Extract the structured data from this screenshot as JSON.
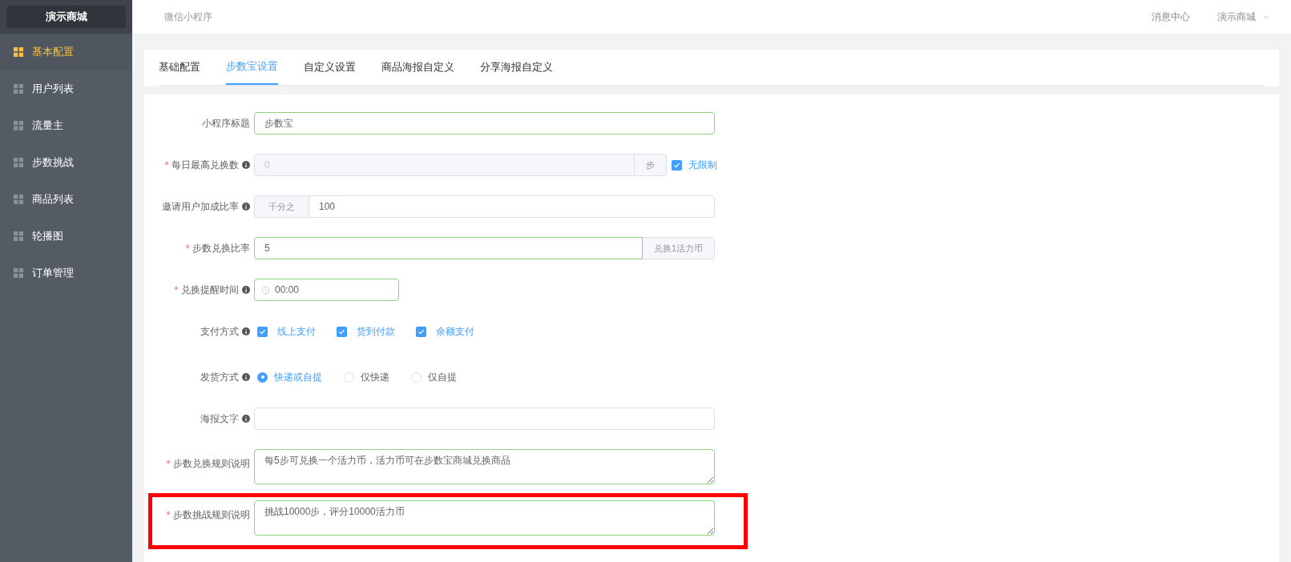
{
  "sidebar": {
    "brand": "演示商城",
    "items": [
      {
        "label": "基本配置",
        "selected": true
      },
      {
        "label": "用户列表",
        "selected": false
      },
      {
        "label": "流量主",
        "selected": false
      },
      {
        "label": "步数挑战",
        "selected": false
      },
      {
        "label": "商品列表",
        "selected": false
      },
      {
        "label": "轮播图",
        "selected": false
      },
      {
        "label": "订单管理",
        "selected": false
      }
    ]
  },
  "header": {
    "breadcrumb": "微信小程序",
    "link": "消息中心",
    "user_menu": "演示商城"
  },
  "tabs": [
    {
      "label": "基础配置",
      "selected": false
    },
    {
      "label": "步数宝设置",
      "selected": true
    },
    {
      "label": "自定义设置",
      "selected": false
    },
    {
      "label": "商品海报自定义",
      "selected": false
    },
    {
      "label": "分享海报自定义",
      "selected": false
    }
  ],
  "form": {
    "fields": [
      {
        "kind": "text",
        "label": "小程序标题",
        "required": false,
        "info": false,
        "valid": true,
        "value": "步数宝"
      },
      {
        "kind": "append",
        "label": "每日最高兑换数",
        "required": true,
        "info": true,
        "valid": false,
        "disabled": true,
        "value": "0",
        "suffix": "步",
        "checkbox": {
          "label": "无限制",
          "checked": true
        }
      },
      {
        "kind": "prepend",
        "label": "邀请用户加成比率",
        "required": false,
        "info": true,
        "valid": false,
        "prefix": "千分之",
        "value": "100"
      },
      {
        "kind": "append",
        "label": "步数兑换比率",
        "required": true,
        "info": false,
        "valid": true,
        "disabled": false,
        "value": "5",
        "suffix": "兑换1活力币"
      },
      {
        "kind": "time",
        "label": "兑换提醒时间",
        "required": true,
        "info": true,
        "valid": true,
        "value": "00:00"
      },
      {
        "kind": "checkboxes",
        "label": "支付方式",
        "required": false,
        "info": true,
        "options": [
          {
            "label": "线上支付",
            "checked": true
          },
          {
            "label": "货到付款",
            "checked": true
          },
          {
            "label": "余额支付",
            "checked": true
          }
        ]
      },
      {
        "kind": "radios",
        "label": "发货方式",
        "required": false,
        "info": true,
        "options": [
          {
            "label": "快递或自提",
            "selected": true
          },
          {
            "label": "仅快递",
            "selected": false
          },
          {
            "label": "仅自提",
            "selected": false
          }
        ]
      },
      {
        "kind": "text",
        "label": "海报文字",
        "required": false,
        "info": true,
        "valid": false
      },
      {
        "kind": "textarea",
        "label": "步数兑换规则说明",
        "required": true,
        "info": false,
        "valid": true,
        "highlighted": false,
        "value": "每5步可兑换一个活力币，活力币可在步数宝商城兑换商品"
      },
      {
        "kind": "textarea",
        "label": "步数挑战规则说明",
        "required": true,
        "info": false,
        "valid": true,
        "highlighted": true,
        "value": "挑战10000步，评分10000活力币"
      }
    ]
  }
}
